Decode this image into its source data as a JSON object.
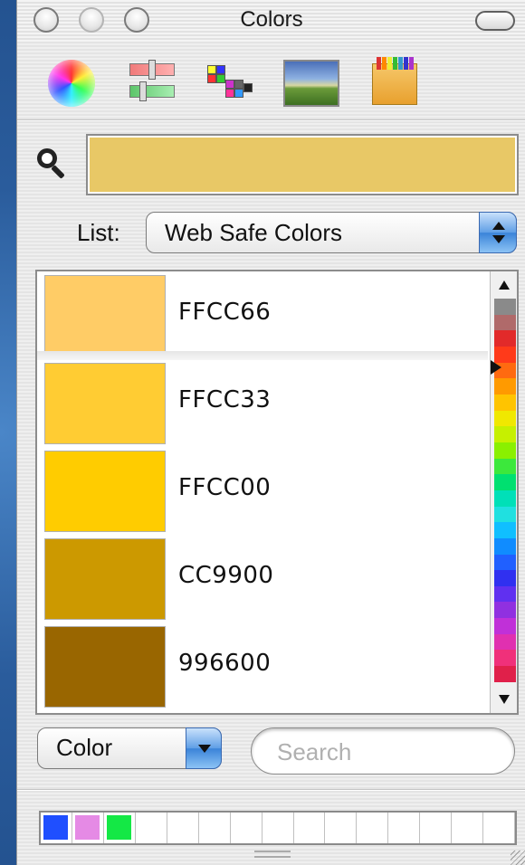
{
  "window": {
    "title": "Colors"
  },
  "toolbar": {
    "modes": [
      {
        "name": "color-wheel-icon"
      },
      {
        "name": "color-sliders-icon"
      },
      {
        "name": "color-palettes-icon"
      },
      {
        "name": "image-palettes-icon"
      },
      {
        "name": "crayons-icon"
      }
    ]
  },
  "current_color": "#E8C866",
  "list_picker": {
    "label": "List:",
    "selected": "Web Safe Colors"
  },
  "color_list": {
    "rows": [
      {
        "hex": "FFCC66",
        "swatch": "#FFCC66",
        "selected": true
      },
      {
        "hex": "FFCC33",
        "swatch": "#FFCC33",
        "selected": false
      },
      {
        "hex": "FFCC00",
        "swatch": "#FFCC00",
        "selected": false
      },
      {
        "hex": "CC9900",
        "swatch": "#CC9900",
        "selected": false
      },
      {
        "hex": "996600",
        "swatch": "#996600",
        "selected": false
      }
    ]
  },
  "bottom": {
    "mode_select": "Color",
    "search_placeholder": "Search"
  },
  "swatch_tray": {
    "colors": [
      "#1F4FFF",
      "#E58AE5",
      "#14E845",
      "",
      "",
      "",
      "",
      "",
      "",
      "",
      "",
      "",
      "",
      "",
      ""
    ]
  }
}
